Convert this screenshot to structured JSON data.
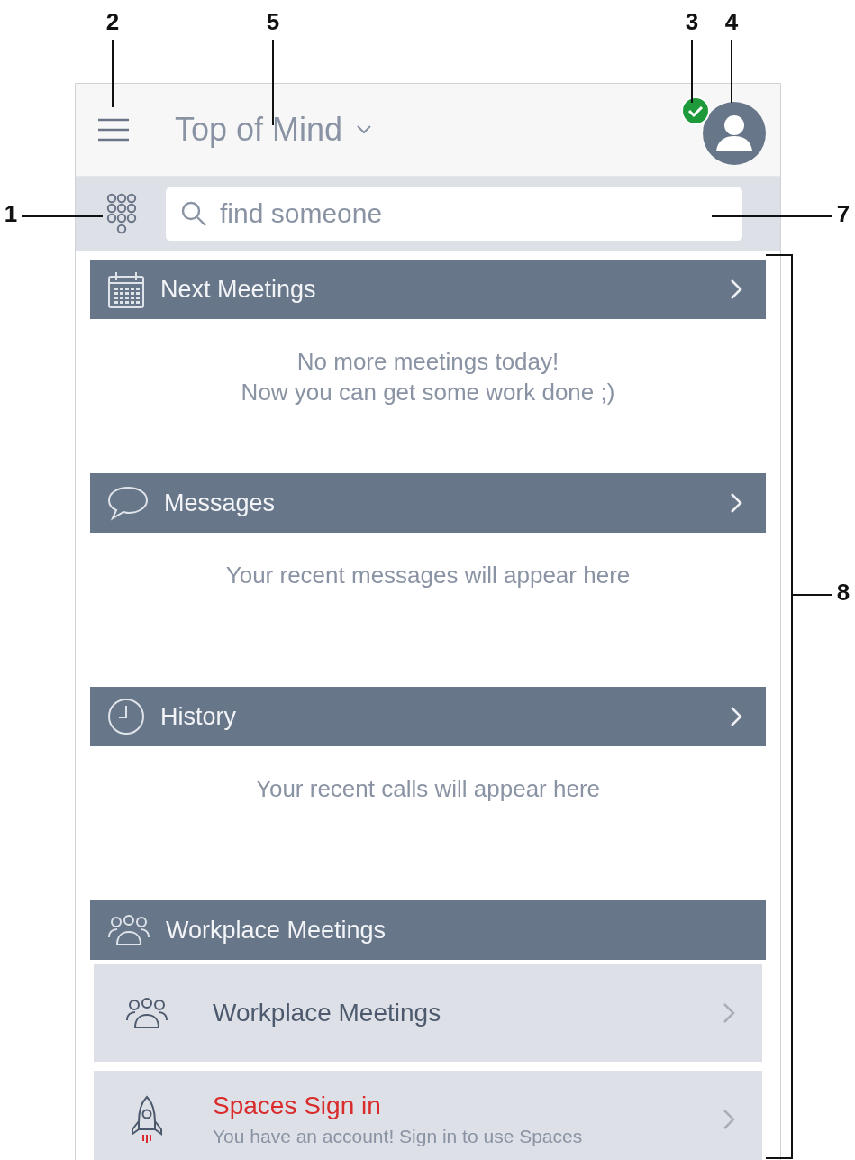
{
  "callouts": [
    {
      "label": "2",
      "kind": "down"
    },
    {
      "label": "5",
      "kind": "down"
    },
    {
      "label": "3",
      "kind": "down"
    },
    {
      "label": "4",
      "kind": "down"
    },
    {
      "label": "1",
      "kind": "right"
    },
    {
      "label": "7",
      "kind": "left"
    },
    {
      "label": "8",
      "kind": "bracket"
    }
  ],
  "header": {
    "title": "Top of Mind",
    "available": true
  },
  "search": {
    "placeholder": "find someone"
  },
  "sections": [
    {
      "title": "Next Meetings",
      "chevron": true,
      "kind": "empty",
      "lines": [
        "No more meetings today!",
        "Now you can get some work done ;)"
      ]
    },
    {
      "title": "Messages",
      "chevron": true,
      "kind": "empty",
      "lines": [
        "Your recent messages will appear here"
      ]
    },
    {
      "title": "History",
      "chevron": true,
      "kind": "empty",
      "lines": [
        "Your recent calls will appear here"
      ]
    },
    {
      "title": "Workplace Meetings",
      "chevron": false,
      "kind": "list",
      "items": [
        {
          "title": "Workplace Meetings",
          "alert": false
        },
        {
          "title": "Spaces Sign in",
          "subtitle": "You have an account! Sign in to use Spaces",
          "alert": true
        }
      ]
    }
  ]
}
